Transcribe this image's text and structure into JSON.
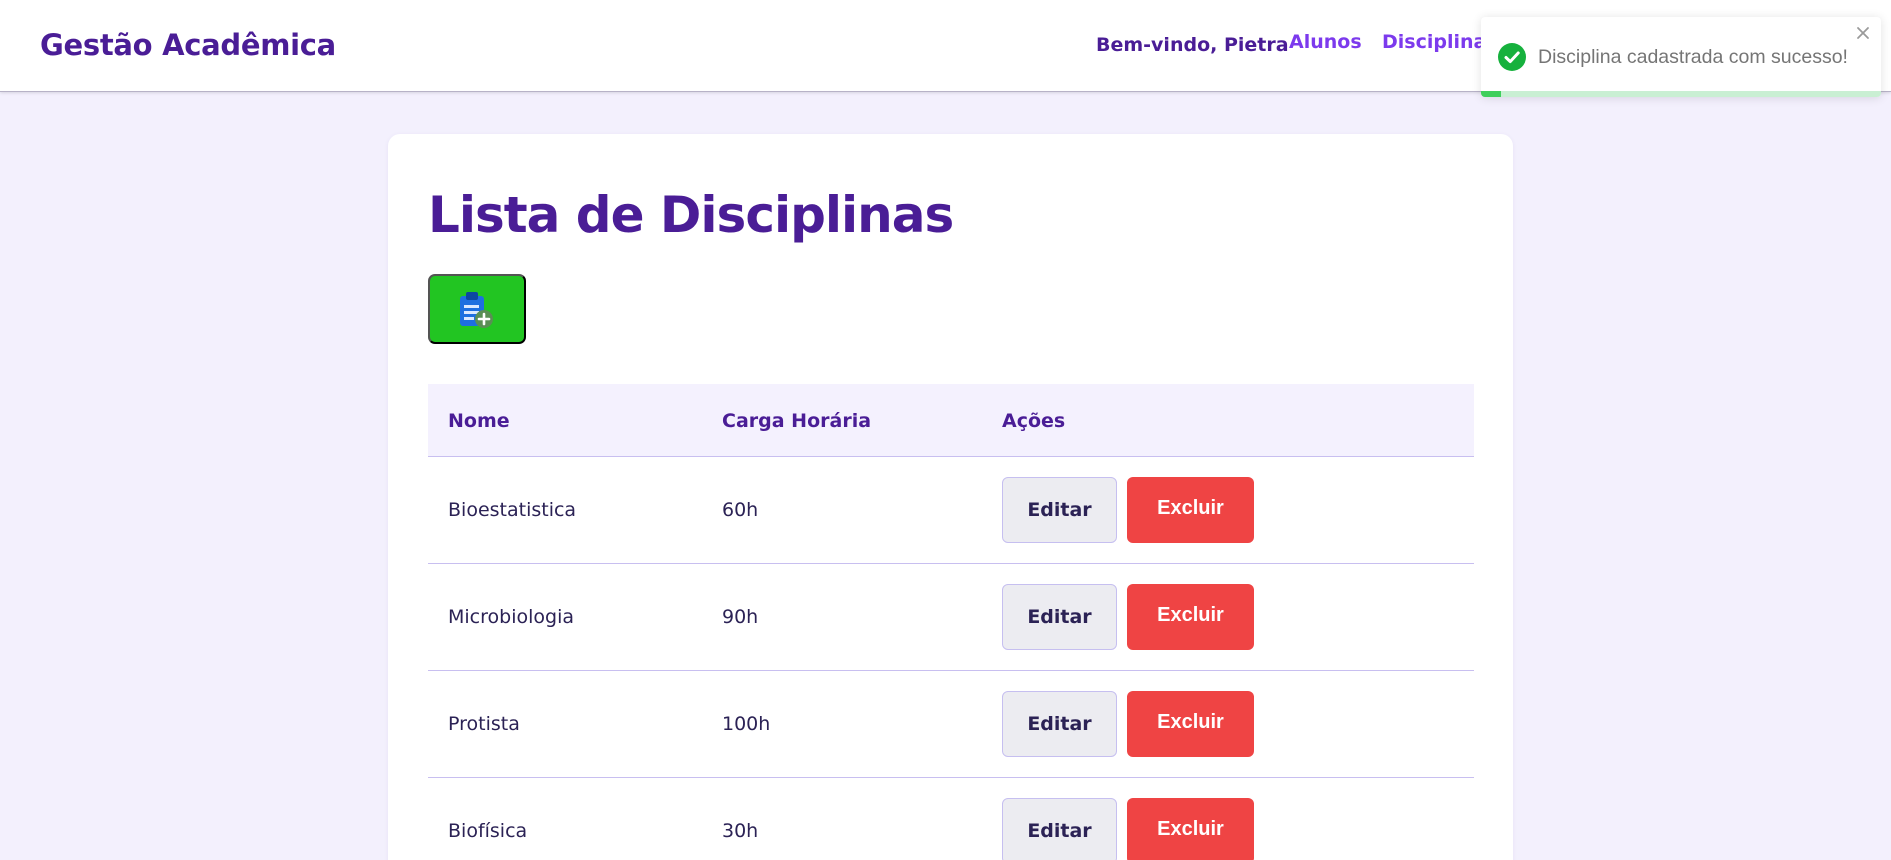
{
  "header": {
    "brand": "Gestão Acadêmica",
    "welcome": "Bem-vindo, Pietra",
    "nav": [
      {
        "label": "Alunos"
      },
      {
        "label": "Disciplinas"
      }
    ]
  },
  "toast": {
    "message": "Disciplina cadastrada com sucesso!",
    "type": "success",
    "icon": "check-circle-icon",
    "progress_fraction": 0.05
  },
  "main": {
    "title": "Lista de Disciplinas",
    "add_button_icon": "clipboard-add-icon",
    "table": {
      "headers": [
        "Nome",
        "Carga Horária",
        "Ações"
      ],
      "rows": [
        {
          "nome": "Bioestatistica",
          "carga": "60h",
          "edit": "Editar",
          "delete": "Excluir"
        },
        {
          "nome": "Microbiologia",
          "carga": "90h",
          "edit": "Editar",
          "delete": "Excluir"
        },
        {
          "nome": "Protista",
          "carga": "100h",
          "edit": "Editar",
          "delete": "Excluir"
        },
        {
          "nome": "Biofísica",
          "carga": "30h",
          "edit": "Editar",
          "delete": "Excluir"
        }
      ]
    }
  },
  "colors": {
    "primary": "#4a1d96",
    "link": "#7c3aed",
    "background": "#f3f0fd",
    "add_button": "#22c522",
    "delete_button": "#ef4444",
    "success": "#16b13d"
  }
}
